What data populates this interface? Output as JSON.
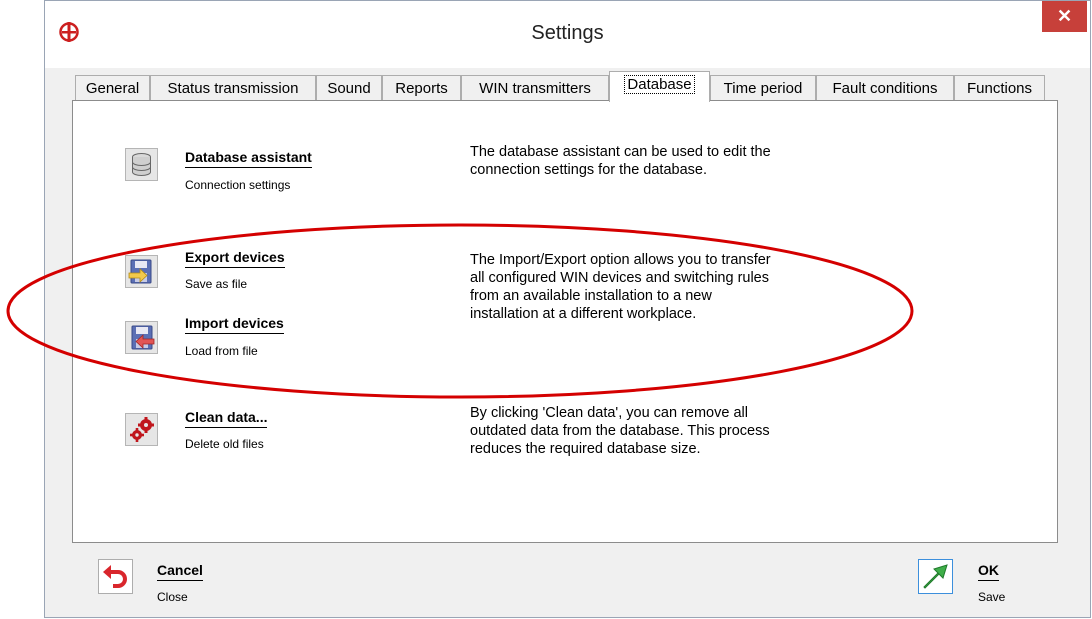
{
  "window": {
    "title": "Settings",
    "close_glyph": "✕"
  },
  "tabs": [
    {
      "label": "General",
      "active": false
    },
    {
      "label": "Status transmission",
      "active": false
    },
    {
      "label": "Sound",
      "active": false
    },
    {
      "label": "Reports",
      "active": false
    },
    {
      "label": "WIN transmitters",
      "active": false
    },
    {
      "label": "Database",
      "active": true
    },
    {
      "label": "Time period",
      "active": false
    },
    {
      "label": "Fault conditions",
      "active": false
    },
    {
      "label": "Functions",
      "active": false
    }
  ],
  "database_assistant": {
    "label": "Database assistant",
    "sub": "Connection settings",
    "icon": "database-icon",
    "desc": [
      "The database assistant can be used to edit the",
      "connection settings for the database."
    ]
  },
  "export_devices": {
    "label": "Export devices",
    "sub": "Save as file",
    "icon": "export-icon"
  },
  "import_devices": {
    "label": "Import devices",
    "sub": "Load from file",
    "icon": "import-icon"
  },
  "import_export_desc": [
    "The Import/Export option allows you to transfer",
    "all configured WIN devices and switching rules",
    "from an available installation to a new",
    "installation at a different workplace."
  ],
  "clean_data": {
    "label": "Clean data...",
    "sub": "Delete old files",
    "icon": "gears-icon",
    "desc": [
      "By clicking 'Clean data', you can remove all",
      "outdated data from the database. This process",
      "reduces the required database size."
    ]
  },
  "footer": {
    "cancel": {
      "label": "Cancel",
      "sub": "Close",
      "icon": "undo-arrow-icon"
    },
    "ok": {
      "label": "OK",
      "sub": "Save",
      "icon": "green-arrow-icon"
    }
  },
  "colors": {
    "annotation": "#d40000",
    "close": "#c7403a",
    "logo": "#cc1f1f"
  }
}
